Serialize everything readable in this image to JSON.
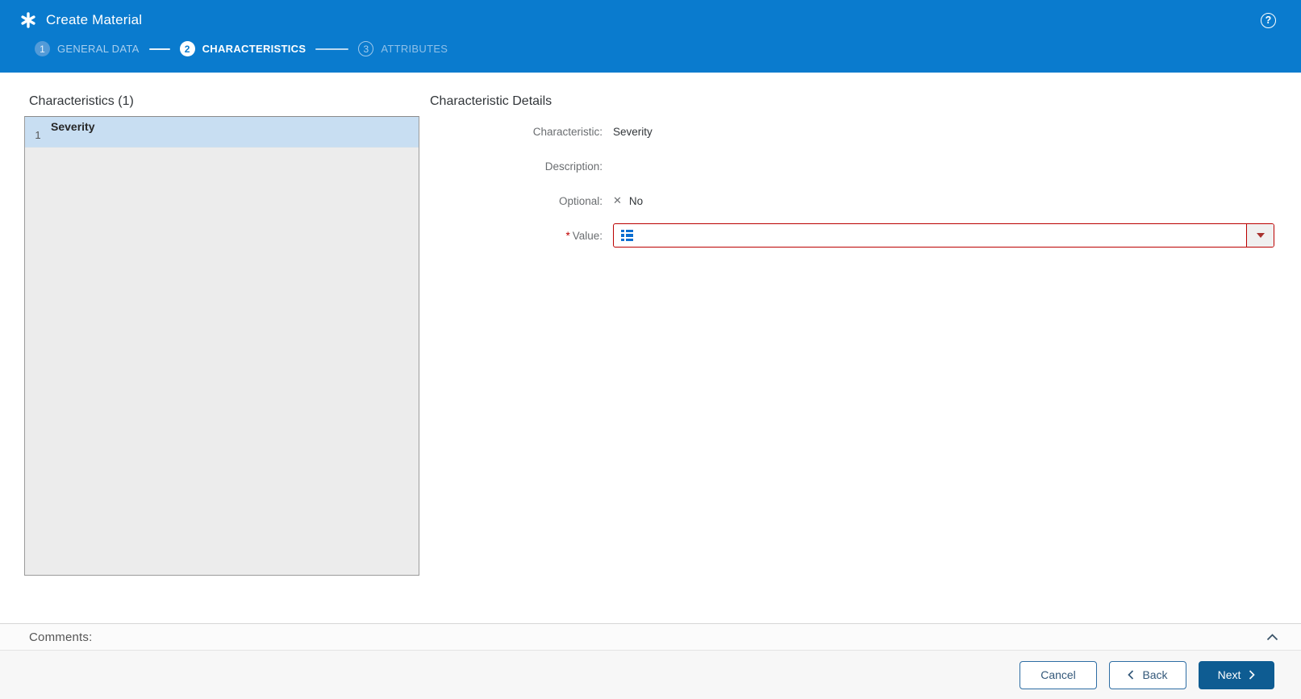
{
  "colors": {
    "header_blue": "#0a7bce",
    "selection_blue": "#c8def2",
    "error_red": "#bb0000",
    "primary_button_blue": "#0e5c92",
    "list_icon_blue": "#0a6ed1"
  },
  "header": {
    "title": "Create Material",
    "create_icon": "asterisk-icon",
    "help_glyph": "?",
    "steps": [
      {
        "number": "1",
        "label": "GENERAL DATA",
        "state": "visited"
      },
      {
        "number": "2",
        "label": "CHARACTERISTICS",
        "state": "current"
      },
      {
        "number": "3",
        "label": "ATTRIBUTES",
        "state": "upcoming"
      }
    ]
  },
  "characteristics_panel": {
    "title": "Characteristics (1)",
    "items": [
      {
        "index": "1",
        "name": "Severity",
        "selected": true
      }
    ]
  },
  "details_panel": {
    "title": "Characteristic Details",
    "characteristic": {
      "label": "Characteristic:",
      "value": "Severity"
    },
    "description": {
      "label": "Description:",
      "value": ""
    },
    "optional": {
      "label": "Optional:",
      "icon": "decline-icon",
      "glyph": "✕",
      "value": "No"
    },
    "value_field": {
      "label": "Value:",
      "required_marker": "*",
      "value": "",
      "placeholder": "",
      "state": "error",
      "icon": "value-list-icon"
    }
  },
  "comments": {
    "label": "Comments:",
    "collapse_icon": "chevron-up-icon"
  },
  "footer": {
    "cancel_label": "Cancel",
    "back_label": "Back",
    "next_label": "Next"
  }
}
